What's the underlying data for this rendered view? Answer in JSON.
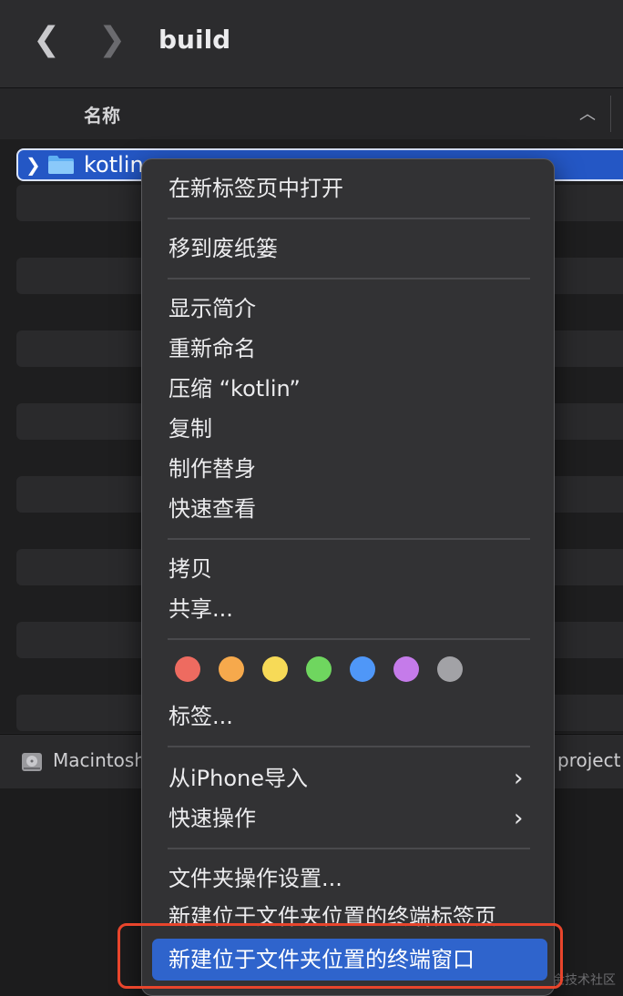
{
  "window": {
    "title": "build"
  },
  "list": {
    "column_header": "名称",
    "rows": [
      {
        "label": "kotlin"
      }
    ]
  },
  "pathbar": {
    "left": "Macintosh",
    "right": "project"
  },
  "watermark": "@稀土掘金技术社区",
  "context_menu": {
    "items": {
      "open_new_tab": "在新标签页中打开",
      "move_to_trash": "移到废纸篓",
      "get_info": "显示简介",
      "rename": "重新命名",
      "compress": "压缩 “kotlin”",
      "duplicate": "复制",
      "make_alias": "制作替身",
      "quick_look": "快速查看",
      "copy": "拷贝",
      "share": "共享...",
      "tags": "标签...",
      "import_from_iphone": "从iPhone导入",
      "quick_actions": "快速操作",
      "folder_actions_setup": "文件夹操作设置...",
      "new_terminal_tab": "新建位于文件夹位置的终端标签页",
      "new_terminal_window": "新建位于文件夹位置的终端窗口"
    },
    "tag_colors": [
      "#ee6b60",
      "#f6a94c",
      "#f7da57",
      "#6fd65f",
      "#4f97f8",
      "#c57bea",
      "#a2a2a6"
    ]
  },
  "colors": {
    "selection": "#2457c5",
    "highlight": "#2f64cc",
    "callout": "#e8452c"
  }
}
